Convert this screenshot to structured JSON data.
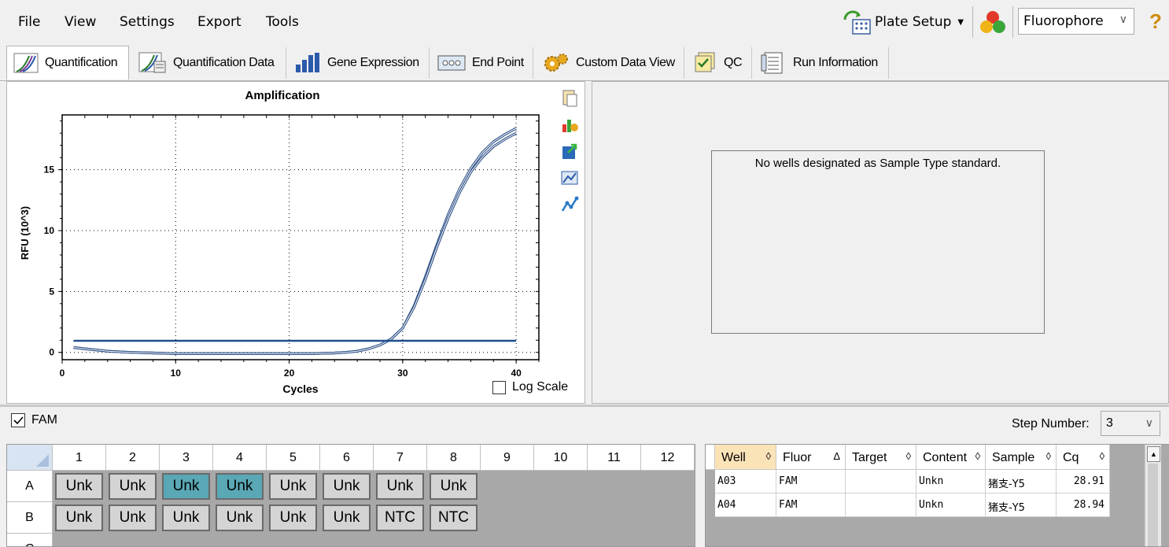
{
  "menu": [
    "File",
    "View",
    "Settings",
    "Export",
    "Tools"
  ],
  "toolbar": {
    "plate_setup": "Plate Setup",
    "fluorophore": "Fluorophore",
    "help": "?"
  },
  "tabs": [
    "Quantification",
    "Quantification Data",
    "Gene Expression",
    "End Point",
    "Custom Data View",
    "QC",
    "Run Information"
  ],
  "chart_data": {
    "type": "line",
    "title": "Amplification",
    "xlabel": "Cycles",
    "ylabel": "RFU (10^3)",
    "xlim": [
      0,
      42
    ],
    "ylim": [
      -0.6,
      19.5
    ],
    "xticks": [
      "0",
      "10",
      "20",
      "30",
      "40"
    ],
    "yticks": [
      "0",
      "5",
      "10",
      "15"
    ],
    "grid": "dotted",
    "series": [
      {
        "x": [
          1,
          2,
          4,
          6,
          8,
          10,
          12,
          14,
          16,
          18,
          20,
          22,
          24,
          25,
          26,
          27,
          28,
          29,
          30,
          31,
          32,
          33,
          34,
          35,
          36,
          37,
          38,
          39,
          40
        ],
        "y": [
          0.4,
          0.3,
          0.1,
          0.0,
          -0.05,
          -0.1,
          -0.1,
          -0.1,
          -0.1,
          -0.1,
          -0.1,
          -0.1,
          -0.05,
          0.0,
          0.1,
          0.3,
          0.6,
          1.1,
          2.0,
          3.8,
          6.2,
          8.8,
          11.3,
          13.4,
          15.1,
          16.4,
          17.3,
          17.9,
          18.4
        ]
      },
      {
        "x": [
          1,
          2,
          4,
          6,
          8,
          10,
          12,
          14,
          16,
          18,
          20,
          22,
          24,
          25,
          26,
          27,
          28,
          29,
          30,
          31,
          32,
          33,
          34,
          35,
          36,
          37,
          38,
          39,
          40
        ],
        "y": [
          0.4,
          0.3,
          0.1,
          0.0,
          -0.05,
          -0.1,
          -0.1,
          -0.1,
          -0.1,
          -0.1,
          -0.1,
          -0.1,
          -0.05,
          0.0,
          0.1,
          0.3,
          0.6,
          1.1,
          2.0,
          3.7,
          6.0,
          8.6,
          11.0,
          13.1,
          14.8,
          16.0,
          16.9,
          17.5,
          18.0
        ]
      }
    ],
    "threshold": 0.95,
    "threshold_x": [
      1,
      40
    ]
  },
  "chart": {
    "log_scale": "Log Scale"
  },
  "std_message": "No wells designated as Sample Type standard.",
  "fam_label": "FAM",
  "step": {
    "label": "Step Number:",
    "value": "3"
  },
  "plate": {
    "columns": [
      "1",
      "2",
      "3",
      "4",
      "5",
      "6",
      "7",
      "8",
      "9",
      "10",
      "11",
      "12"
    ],
    "rows": [
      "A",
      "B",
      "C"
    ],
    "A": [
      "Unk",
      "Unk",
      "Unk",
      "Unk",
      "Unk",
      "Unk",
      "Unk",
      "Unk"
    ],
    "B": [
      "Unk",
      "Unk",
      "Unk",
      "Unk",
      "Unk",
      "Unk",
      "NTC",
      "NTC"
    ],
    "selected_A": [
      3,
      4
    ]
  },
  "table": {
    "headers": [
      "Well",
      "Fluor",
      "Target",
      "Content",
      "Sample",
      "Cq"
    ],
    "sort_marks": [
      "◊",
      "Δ",
      "◊",
      "◊",
      "◊",
      "◊"
    ],
    "rows": [
      [
        "A03",
        "FAM",
        "",
        "Unkn",
        "猪支-Y5",
        "28.91"
      ],
      [
        "A04",
        "FAM",
        "",
        "Unkn",
        "猪支-Y5",
        "28.94"
      ]
    ]
  }
}
